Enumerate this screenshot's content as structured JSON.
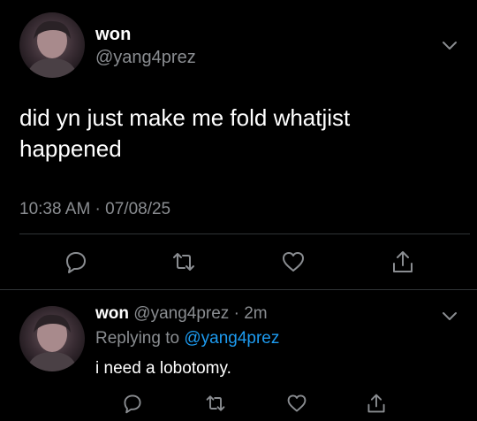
{
  "main_tweet": {
    "display_name": "won",
    "handle": "@yang4prez",
    "text_line1": "did yn just make me fold whatjist",
    "text_line2": "happened",
    "timestamp": "10:38 AM · 07/08/25"
  },
  "reply_tweet": {
    "display_name": "won",
    "handle": "@yang4prez",
    "separator": " · ",
    "time_ago": "2m",
    "replying_prefix": "Replying to ",
    "replying_to": "@yang4prez",
    "text": "i need a lobotomy."
  },
  "icons": {
    "reply": "reply-icon",
    "retweet": "retweet-icon",
    "like": "like-icon",
    "share": "share-icon",
    "more": "chevron-down-icon",
    "avatar": "avatar"
  },
  "colors": {
    "background": "#000000",
    "primary_text": "#ffffff",
    "secondary_text": "#8a8d91",
    "link": "#1d9bf0",
    "divider": "#2f3336"
  }
}
